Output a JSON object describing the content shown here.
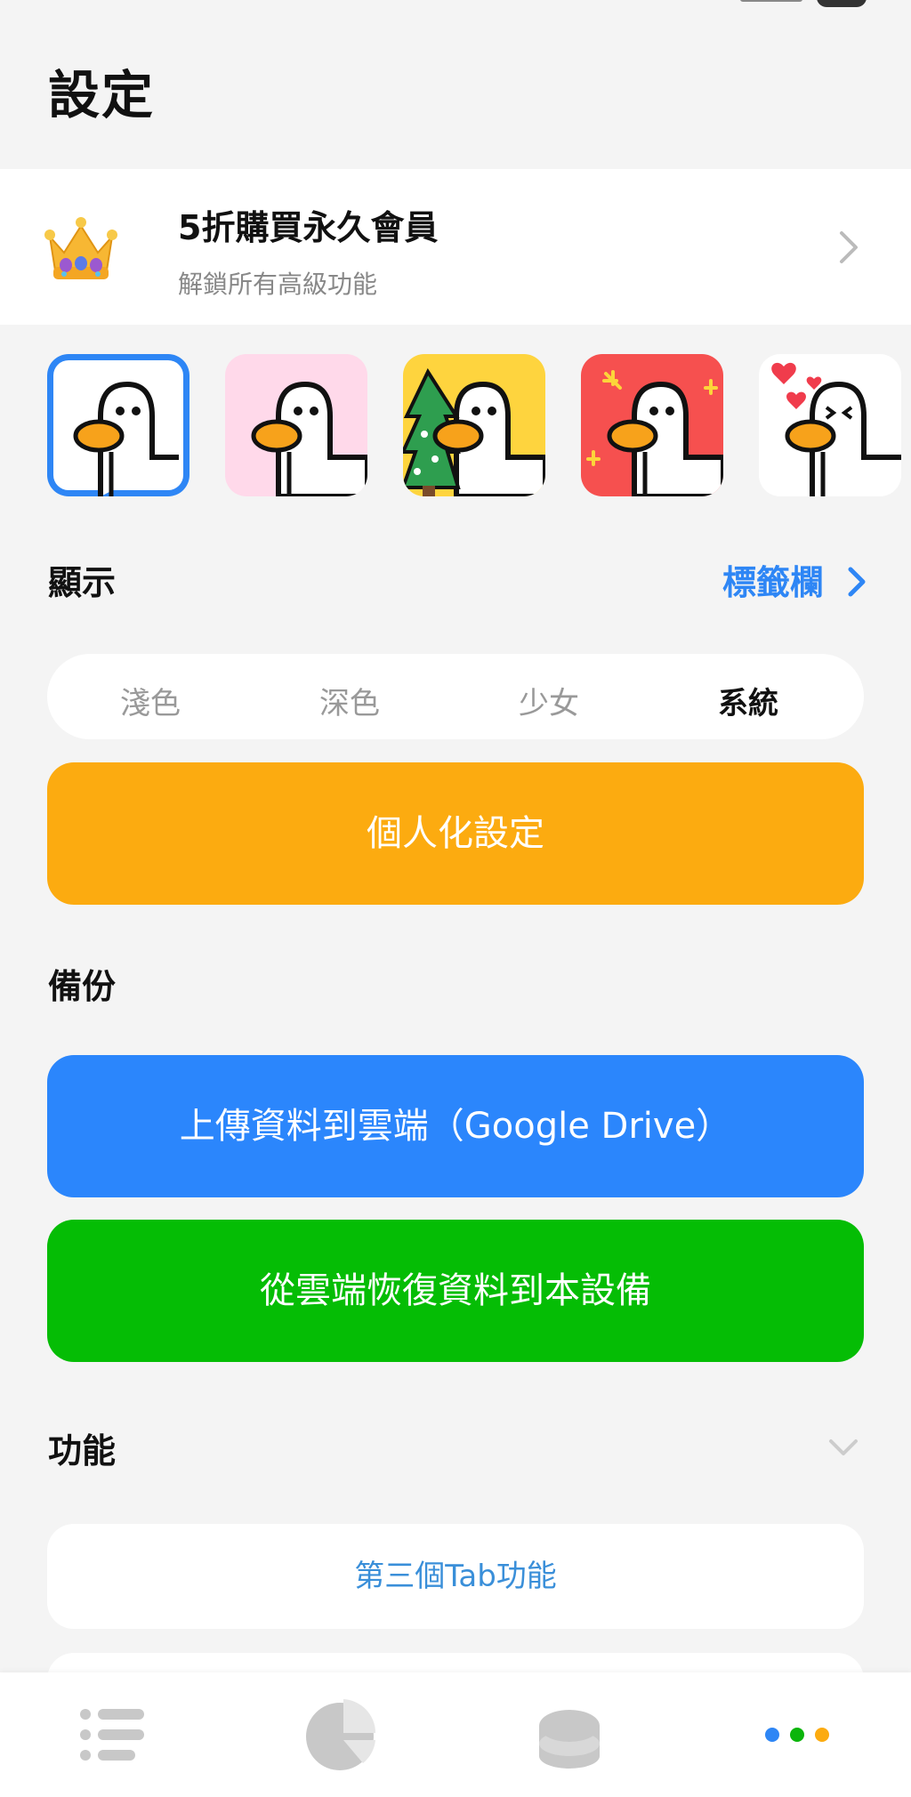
{
  "page": {
    "title": "設定"
  },
  "promo": {
    "title": "5折購買永久會員",
    "subtitle": "解鎖所有高級功能",
    "icon": "crown-icon"
  },
  "app_icons": {
    "selected_index": 0,
    "items": [
      "duck-white",
      "duck-pink",
      "duck-christmas-tree",
      "duck-red-firework",
      "duck-hearts"
    ]
  },
  "display": {
    "label": "顯示",
    "tab_bar_link": "標籤欄",
    "themes": [
      "淺色",
      "深色",
      "少女",
      "系統"
    ],
    "active_theme": "系統",
    "personalize_button": "個人化設定"
  },
  "backup": {
    "label": "備份",
    "upload_button": "上傳資料到雲端（Google Drive）",
    "restore_button": "從雲端恢復資料到本設備"
  },
  "features": {
    "label": "功能",
    "items": [
      "第三個Tab功能"
    ]
  },
  "bottom_nav": {
    "items": [
      "list-icon",
      "pie-chart-icon",
      "coin-stack-icon",
      "more-dots-icon"
    ],
    "active": "more-dots-icon"
  },
  "colors": {
    "accent_blue": "#2e86f5",
    "orange": "#fcab10",
    "blue_button": "#2b86fc",
    "green_button": "#05bd05"
  }
}
